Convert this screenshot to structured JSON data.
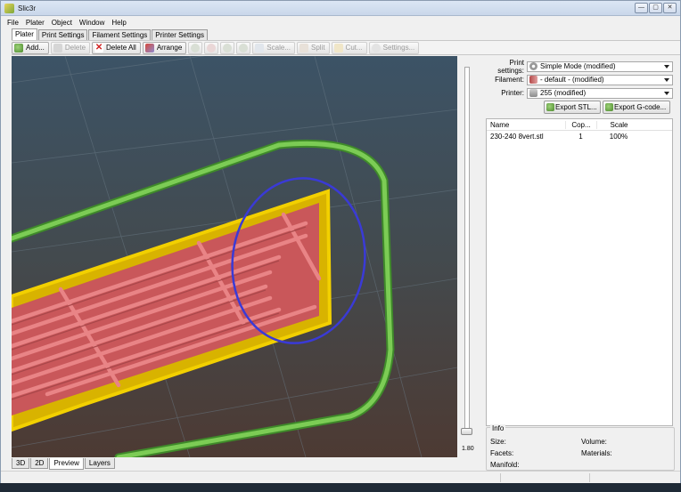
{
  "window": {
    "title": "Slic3r",
    "controls": [
      "—",
      "▢",
      "✕"
    ]
  },
  "menu": [
    "File",
    "Plater",
    "Object",
    "Window",
    "Help"
  ],
  "tabs": [
    {
      "label": "Plater",
      "active": true
    },
    {
      "label": "Print Settings",
      "active": false
    },
    {
      "label": "Filament Settings",
      "active": false
    },
    {
      "label": "Printer Settings",
      "active": false
    }
  ],
  "toolbar": {
    "add": "Add...",
    "delete": "Delete",
    "delete_all": "Delete All",
    "arrange": "Arrange",
    "scale": "Scale...",
    "split": "Split",
    "cut": "Cut...",
    "settings": "Settings..."
  },
  "settings": {
    "print_label": "Print settings:",
    "print_value": "Simple Mode (modified)",
    "filament_label": "Filament:",
    "filament_value": "- default - (modified)",
    "printer_label": "Printer:",
    "printer_value": "255 (modified)"
  },
  "export": {
    "stl": "Export STL...",
    "gcode": "Export G-code..."
  },
  "object_list": {
    "headers": {
      "name": "Name",
      "copies": "Cop...",
      "scale": "Scale"
    },
    "rows": [
      {
        "name": "230-240 8vert.stl",
        "copies": "1",
        "scale": "100%"
      }
    ]
  },
  "info": {
    "title": "Info",
    "size": "Size:",
    "volume": "Volume:",
    "facets": "Facets:",
    "materials": "Materials:",
    "manifold": "Manifold:"
  },
  "slider": {
    "value": "1.80"
  },
  "view_tabs": [
    {
      "label": "3D",
      "active": false
    },
    {
      "label": "2D",
      "active": false
    },
    {
      "label": "Preview",
      "active": true
    },
    {
      "label": "Layers",
      "active": false
    }
  ],
  "colors": {
    "skirt": "#6cc24a",
    "perimeter": "#f2d000",
    "infill": "#e06a6a",
    "annotation": "#3a3ad6"
  }
}
